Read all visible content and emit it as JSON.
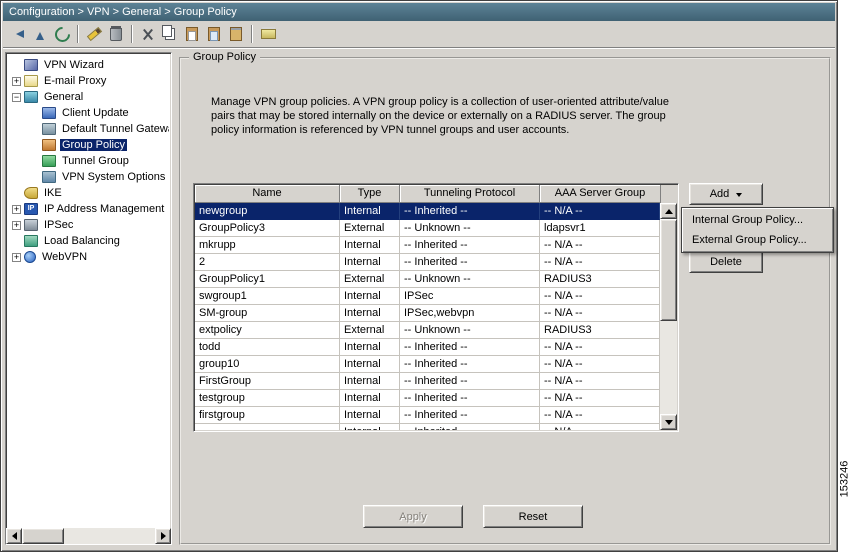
{
  "window_title": "Configuration > VPN > General > Group Policy",
  "toolbar": {
    "buttons": [
      {
        "icon": "go-back"
      },
      {
        "icon": "go-up"
      },
      {
        "icon": "refresh",
        "sep_after": true
      },
      {
        "icon": "edit"
      },
      {
        "icon": "delete",
        "sep_after": true
      },
      {
        "icon": "cut"
      },
      {
        "icon": "copy"
      },
      {
        "icon": "paste"
      },
      {
        "icon": "paste-special"
      },
      {
        "icon": "clipboard",
        "sep_after": true
      },
      {
        "icon": "print"
      }
    ]
  },
  "sidebar": {
    "items": [
      {
        "label": "VPN Wizard",
        "level": 0,
        "icon": "wizard"
      },
      {
        "label": "E-mail Proxy",
        "level": 0,
        "icon": "mail",
        "expander": "plus"
      },
      {
        "label": "General",
        "level": 0,
        "icon": "general",
        "expander": "minus"
      },
      {
        "label": "Client Update",
        "level": 1,
        "icon": "client-update"
      },
      {
        "label": "Default Tunnel Gateway",
        "level": 1,
        "icon": "gateway"
      },
      {
        "label": "Group Policy",
        "level": 1,
        "icon": "group-policy",
        "selected": true
      },
      {
        "label": "Tunnel Group",
        "level": 1,
        "icon": "tunnel-group"
      },
      {
        "label": "VPN System Options",
        "level": 1,
        "icon": "vpn-system"
      },
      {
        "label": "IKE",
        "level": 0,
        "icon": "ike"
      },
      {
        "label": "IP Address Management",
        "level": 0,
        "icon": "ip",
        "expander": "plus"
      },
      {
        "label": "IPSec",
        "level": 0,
        "icon": "ipsec",
        "expander": "plus"
      },
      {
        "label": "Load Balancing",
        "level": 0,
        "icon": "load-balancing"
      },
      {
        "label": "WebVPN",
        "level": 0,
        "icon": "webvpn",
        "expander": "plus"
      }
    ]
  },
  "panel": {
    "legend": "Group Policy",
    "description_lines": [
      "Manage VPN group policies. A VPN group policy is a collection of user-oriented attribute/value",
      "pairs that may be stored internally on the device or externally on a RADIUS server. The group",
      "policy information is referenced by VPN tunnel groups and user accounts."
    ],
    "table": {
      "headers": [
        "Name",
        "Type",
        "Tunneling Protocol",
        "AAA Server Group"
      ],
      "rows": [
        {
          "name": "newgroup",
          "type": "Internal",
          "protocol": "-- Inherited --",
          "aaa": "-- N/A --",
          "selected": true
        },
        {
          "name": "GroupPolicy3",
          "type": "External",
          "protocol": "-- Unknown --",
          "aaa": "ldapsvr1"
        },
        {
          "name": "mkrupp",
          "type": "Internal",
          "protocol": "-- Inherited --",
          "aaa": "-- N/A --"
        },
        {
          "name": "2",
          "type": "Internal",
          "protocol": "-- Inherited --",
          "aaa": "-- N/A --"
        },
        {
          "name": "GroupPolicy1",
          "type": "External",
          "protocol": "-- Unknown --",
          "aaa": "RADIUS3"
        },
        {
          "name": "swgroup1",
          "type": "Internal",
          "protocol": "IPSec",
          "aaa": "-- N/A --"
        },
        {
          "name": "SM-group",
          "type": "Internal",
          "protocol": "IPSec,webvpn",
          "aaa": "-- N/A --"
        },
        {
          "name": "extpolicy",
          "type": "External",
          "protocol": "-- Unknown --",
          "aaa": "RADIUS3"
        },
        {
          "name": "todd",
          "type": "Internal",
          "protocol": "-- Inherited --",
          "aaa": "-- N/A --"
        },
        {
          "name": "group10",
          "type": "Internal",
          "protocol": "-- Inherited --",
          "aaa": "-- N/A --"
        },
        {
          "name": "FirstGroup",
          "type": "Internal",
          "protocol": "-- Inherited --",
          "aaa": "-- N/A --"
        },
        {
          "name": "testgroup",
          "type": "Internal",
          "protocol": "-- Inherited --",
          "aaa": "-- N/A --"
        },
        {
          "name": "firstgroup",
          "type": "Internal",
          "protocol": "-- Inherited --",
          "aaa": "-- N/A --"
        },
        {
          "name": "",
          "type": "Internal",
          "protocol": "-- Inherited --",
          "aaa": "-- N/A --"
        }
      ]
    },
    "buttons": {
      "add": "Add",
      "delete": "Delete",
      "apply": "Apply",
      "reset": "Reset"
    },
    "menu_items": [
      "Internal Group Policy...",
      "External Group Policy..."
    ]
  },
  "figure_number": "153246"
}
